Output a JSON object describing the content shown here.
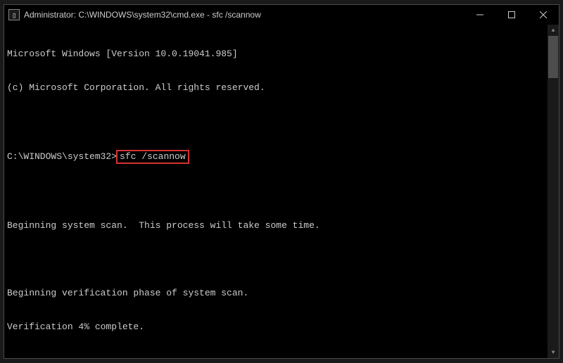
{
  "titlebar": {
    "icon_glyph": "▯",
    "title": "Administrator: C:\\WINDOWS\\system32\\cmd.exe - sfc  /scannow"
  },
  "terminal": {
    "header_line1": "Microsoft Windows [Version 10.0.19041.985]",
    "header_line2": "(c) Microsoft Corporation. All rights reserved.",
    "prompt": "C:\\WINDOWS\\system32>",
    "command": "sfc /scannow",
    "output_line1": "Beginning system scan.  This process will take some time.",
    "output_line2": "Beginning verification phase of system scan.",
    "output_line3": "Verification 4% complete."
  }
}
